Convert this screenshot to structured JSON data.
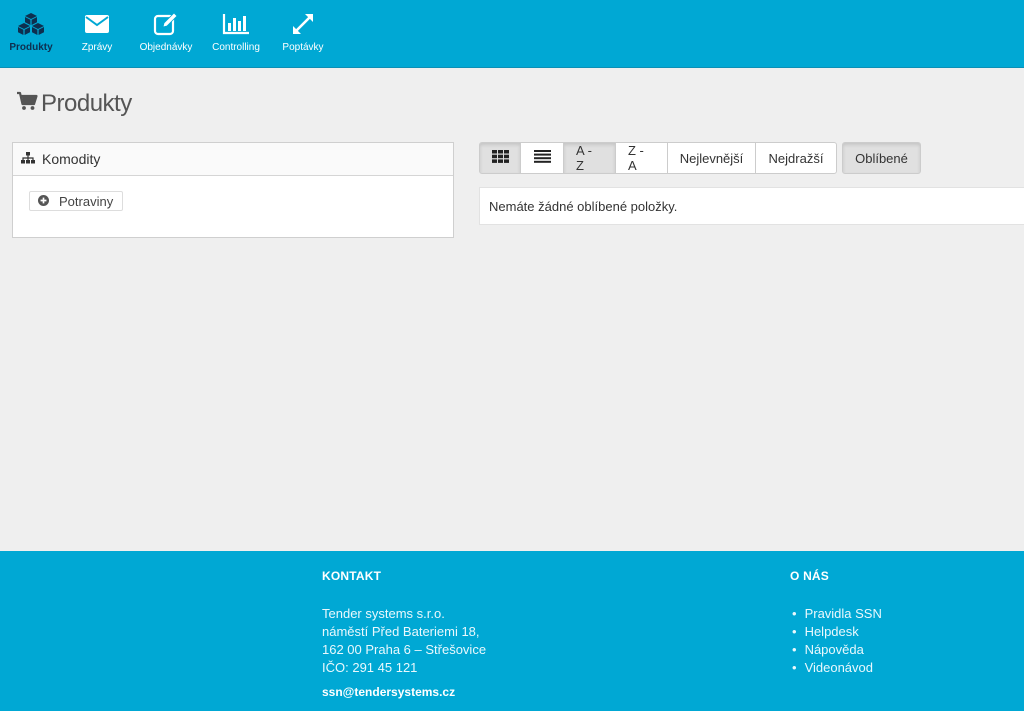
{
  "nav": {
    "items": [
      {
        "label": "Produkty",
        "icon": "cubes-icon",
        "active": true
      },
      {
        "label": "Zprávy",
        "icon": "envelope-icon"
      },
      {
        "label": "Objednávky",
        "icon": "edit-icon"
      },
      {
        "label": "Controlling",
        "icon": "bar-chart-icon"
      },
      {
        "label": "Poptávky",
        "icon": "expand-icon"
      }
    ]
  },
  "page": {
    "title": "Produkty",
    "title_icon": "cart-icon"
  },
  "categories": {
    "header": "Komodity",
    "header_icon": "sitemap-icon",
    "items": [
      {
        "label": "Potraviny",
        "icon": "plus-circle-icon"
      }
    ]
  },
  "toolbar": {
    "grid_view_icon": "grid-icon",
    "list_view_icon": "list-icon",
    "sort_az": "A - Z",
    "sort_za": "Z - A",
    "sort_cheapest": "Nejlevnější",
    "sort_most_expensive": "Nejdražší",
    "favorites": "Oblíbené"
  },
  "notice": {
    "text": "Nemáte žádné oblíbené položky."
  },
  "footer": {
    "contact_heading": "KONTAKT",
    "company": "Tender systems s.r.o.",
    "street": "náměstí Před Bateriemi 18,",
    "city": "162 00 Praha 6 – Střešovice",
    "ico": "IČO: 291 45 121",
    "email": "ssn@tendersystems.cz",
    "about_heading": "O NÁS",
    "links": [
      "Pravidla SSN",
      "Helpdesk",
      "Nápověda",
      "Videonávod"
    ],
    "bullet": "•"
  },
  "colors": {
    "brand": "#00a8d4",
    "active_nav_text": "#0e2f4f",
    "page_bg": "#efefef"
  }
}
